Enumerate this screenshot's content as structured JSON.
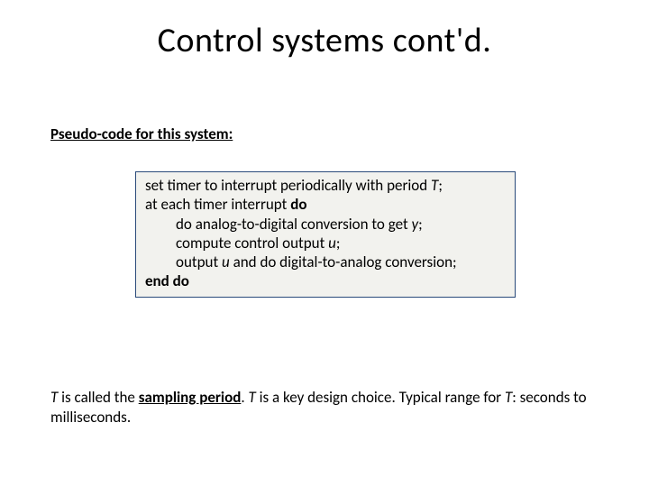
{
  "title": "Control systems cont'd.",
  "section_label": "Pseudo-code for this system:",
  "code": {
    "l1_a": "set timer to interrupt periodically with period ",
    "l1_b": "T",
    "l1_c": ";",
    "l2_a": "at each timer interrupt ",
    "l2_b": "do",
    "l3_a": "do analog-to-digital conversion to get ",
    "l3_b": "y",
    "l3_c": ";",
    "l4_a": "compute control output ",
    "l4_b": "u",
    "l4_c": ";",
    "l5_a": "output ",
    "l5_b": "u",
    "l5_c": " and do digital-to-analog conversion;",
    "l6": "end do"
  },
  "footer": {
    "p1_a": "T",
    "p1_b": " is called the ",
    "p1_c": "sampling period",
    "p1_d": ".  ",
    "p1_e": "T",
    "p1_f": " is a key design choice.  Typical range for ",
    "p1_g": "T",
    "p1_h": ": seconds to milliseconds."
  }
}
